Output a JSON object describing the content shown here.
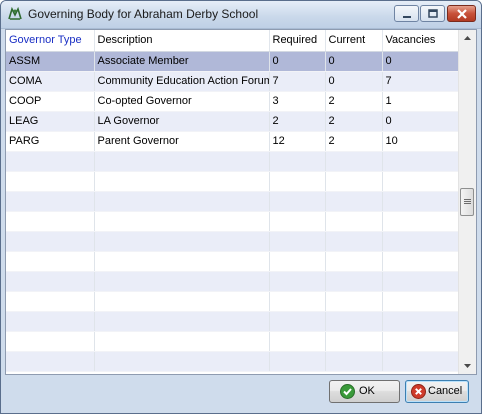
{
  "window": {
    "title": "Governing Body for Abraham Derby School",
    "icon": "school-crest-icon"
  },
  "titlebar_buttons": [
    "minimize-icon",
    "maximize-icon",
    "close-icon"
  ],
  "grid": {
    "columns": [
      "Governor Type",
      "Description",
      "Required",
      "Current",
      "Vacancies"
    ],
    "sorted_column": "Governor Type",
    "rows": [
      [
        "ASSM",
        "Associate Member",
        "0",
        "0",
        "0"
      ],
      [
        "COMA",
        "Community Education Action Forum",
        "7",
        "0",
        "7"
      ],
      [
        "COOP",
        "Co-opted Governor",
        "3",
        "2",
        "1"
      ],
      [
        "LEAG",
        "LA Governor",
        "2",
        "2",
        "0"
      ],
      [
        "PARG",
        "Parent Governor",
        "12",
        "2",
        "10"
      ]
    ],
    "selected_row_index": 0,
    "empty_row_count": 11
  },
  "colors": {
    "selected_row": "#b0b8d8",
    "alt_row": "#eaedf8",
    "sorted_header": "#1a2fc4"
  },
  "buttons": {
    "ok": {
      "label": "OK",
      "icon": "check-circle-icon"
    },
    "cancel": {
      "label": "Cancel",
      "icon": "cross-circle-icon"
    }
  }
}
